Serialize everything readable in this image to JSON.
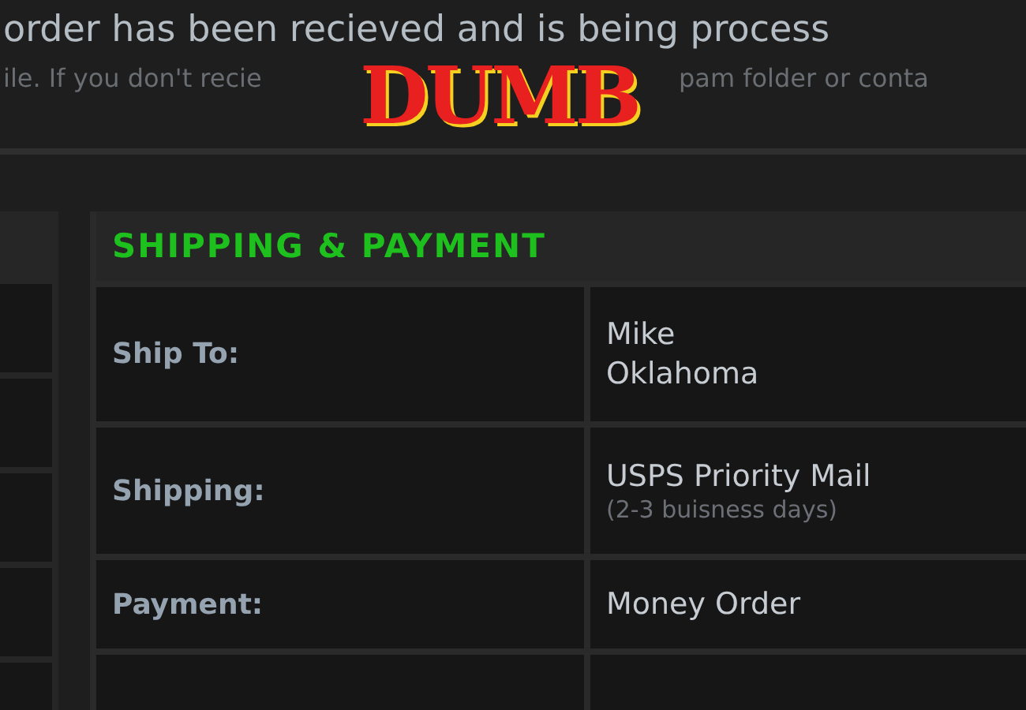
{
  "headline": "order has been recieved and is being process",
  "subline_parts": [
    "ile. If you don't recie",
    "pam folder or conta"
  ],
  "overlay_caption": "DUMB",
  "section": {
    "title": "SHIPPING & PAYMENT",
    "rows": [
      {
        "label": "Ship To:",
        "lines": [
          "Mike",
          "Oklahoma"
        ]
      },
      {
        "label": "Shipping:",
        "lines": [
          "USPS Priority Mail"
        ],
        "note": "(2-3 buisness days)"
      },
      {
        "label": "Payment:",
        "lines": [
          "Money Order"
        ]
      }
    ]
  }
}
